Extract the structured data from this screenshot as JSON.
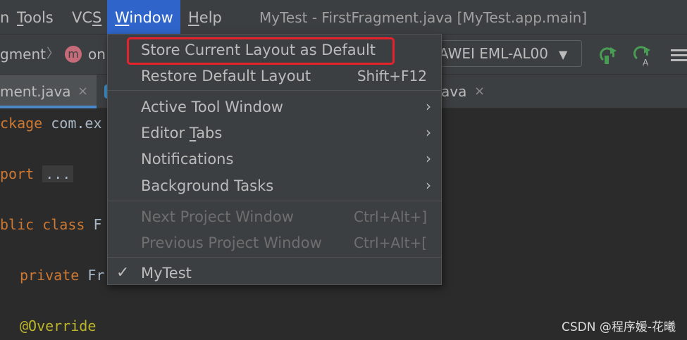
{
  "menubar": {
    "items": [
      {
        "label": "n"
      },
      {
        "label": "Tools",
        "mnemonic": "T",
        "rest": "ools"
      },
      {
        "label": "VCS",
        "mnemonic": "S",
        "rest": "VC"
      },
      {
        "label": "Window",
        "mnemonic": "W",
        "rest": "indow"
      },
      {
        "label": "Help",
        "mnemonic": "H",
        "rest": "elp"
      }
    ],
    "window_title": "MyTest - FirstFragment.java [MyTest.app.main]"
  },
  "navbar": {
    "breadcrumb_fragment": "gment",
    "breadcrumb_separator": "〉",
    "method_badge": "m",
    "method_text": "on",
    "device": "AWEI EML-AL00",
    "device_arrow": "▼"
  },
  "tabs": {
    "active_label": "ment.java",
    "other_label": "ava",
    "close_glyph": "×"
  },
  "editor": {
    "line1_kw": "ckage",
    "line1_rest": " com.ex",
    "line2_kw": "port",
    "line2_fold": "...",
    "line3_kw": "blic class",
    "line3_rest": " F",
    "line4_kw": "private",
    "line4_rest": " Fr",
    "line5_ann": "@Override"
  },
  "menu": {
    "store_layout": "Store Current Layout as Default",
    "restore_layout": "Restore Default Layout",
    "restore_shortcut": "Shift+F12",
    "active_tool_window": "Active Tool Window",
    "editor_tabs_pre": "Editor ",
    "editor_tabs_mn": "T",
    "editor_tabs_post": "abs",
    "notifications": "Notifications",
    "background_tasks": "Background Tasks",
    "next_project": "Next Project Window",
    "next_shortcut": "Ctrl+Alt+]",
    "prev_project": "Previous Project Window",
    "prev_shortcut": "Ctrl+Alt+[",
    "mytest": "MyTest",
    "check_glyph": "✓",
    "submenu_arrow": "›"
  },
  "watermark": "CSDN @程序媛-花曦",
  "colors": {
    "menu_bg": "#3c3f41",
    "active_menu": "#2f65ca",
    "highlight_box": "#e8222b",
    "run_green": "#499c54"
  }
}
